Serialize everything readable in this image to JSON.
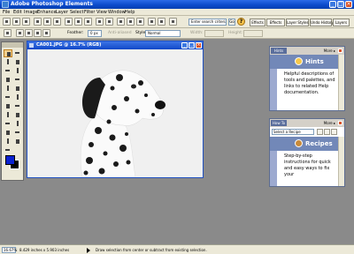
{
  "window": {
    "title": "Adobe Photoshop Elements",
    "min_glyph": "_",
    "max_glyph": "□",
    "close_glyph": "×"
  },
  "menu": [
    "File",
    "Edit",
    "Image",
    "Enhance",
    "Layer",
    "Select",
    "Filter",
    "View",
    "Window",
    "Help"
  ],
  "shortcuts": {
    "search_placeholder": "Enter search criteria",
    "search_go": "Go",
    "help_glyph": "?",
    "palette_tabs": [
      "Effects",
      "Effects",
      "Layer Styles",
      "Undo History",
      "Layers"
    ]
  },
  "options": {
    "feather_label": "Feather:",
    "feather_value": "0 px",
    "antialias_label": "Anti-aliased",
    "style_label": "Style:",
    "style_value": "Normal",
    "width_label": "Width:",
    "height_label": "Height:"
  },
  "document": {
    "title": "CA001.JPG @ 16.7% (RGB)"
  },
  "hints_palette": {
    "tab": "Hints",
    "more": "More ▸",
    "heading": "Hints",
    "body": "Helpful descriptions of tools and palettes, and links to related Help documentation."
  },
  "recipes_palette": {
    "tab": "How To",
    "more": "More ▸",
    "select_value": "Select a Recipe",
    "heading": "Recipes",
    "body": "Step-by-step instructions for quick and easy ways to fix your"
  },
  "status": {
    "zoom": "16.67%",
    "doc_size": "8.429 inches x 5.903 inches",
    "hint": "Draw selection from center or subtract from existing selection."
  },
  "colors": {
    "titlebar": "#0a49c9",
    "foreground_swatch": "#0a22d0",
    "background_swatch": "#000000",
    "palette_header": "#7288b8"
  }
}
